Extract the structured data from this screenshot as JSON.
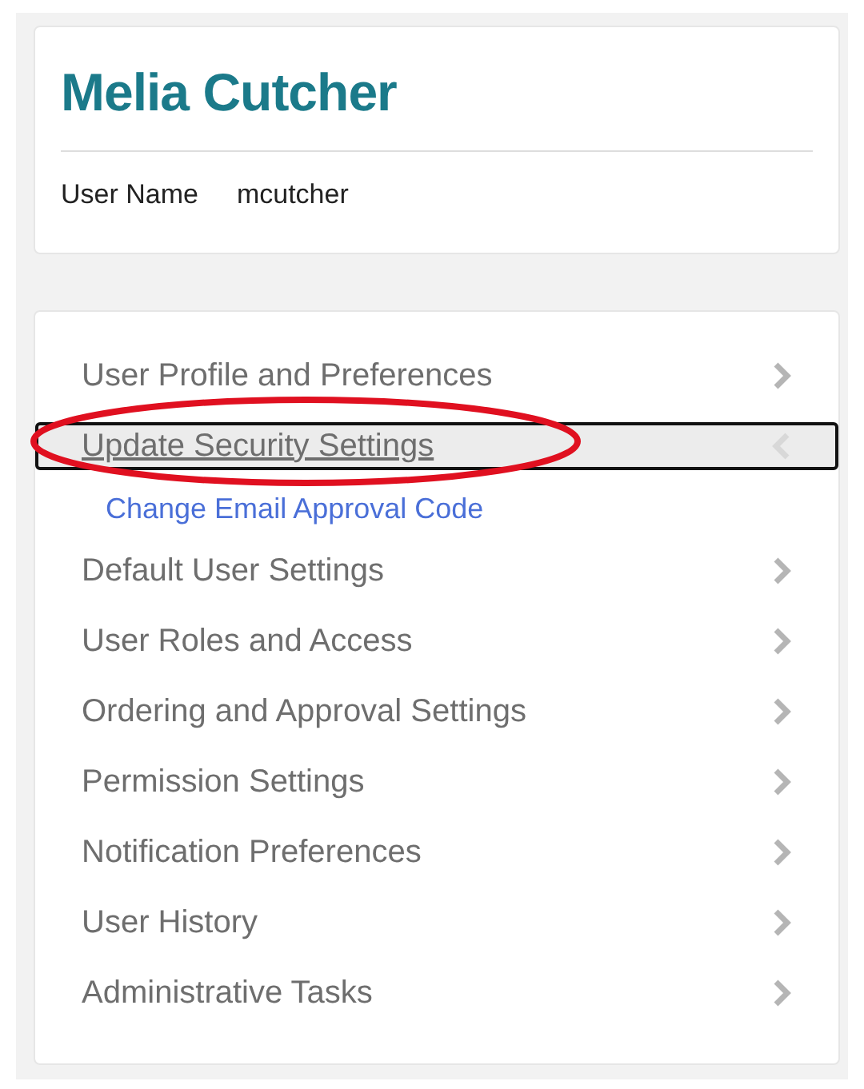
{
  "profile": {
    "name": "Melia Cutcher",
    "field_label": "User Name",
    "field_value": "mcutcher"
  },
  "menu": [
    {
      "label": "User Profile and Preferences",
      "selected": false,
      "expanded": false,
      "circled": false
    },
    {
      "label": "Update Security Settings",
      "selected": true,
      "expanded": true,
      "circled": true,
      "children": [
        {
          "label": "Change Email Approval Code"
        }
      ]
    },
    {
      "label": "Default User Settings",
      "selected": false,
      "expanded": false,
      "circled": false
    },
    {
      "label": "User Roles and Access",
      "selected": false,
      "expanded": false,
      "circled": false
    },
    {
      "label": "Ordering and Approval Settings",
      "selected": false,
      "expanded": false,
      "circled": false
    },
    {
      "label": "Permission Settings",
      "selected": false,
      "expanded": false,
      "circled": false
    },
    {
      "label": "Notification Preferences",
      "selected": false,
      "expanded": false,
      "circled": false
    },
    {
      "label": "User History",
      "selected": false,
      "expanded": false,
      "circled": false
    },
    {
      "label": "Administrative Tasks",
      "selected": false,
      "expanded": false,
      "circled": false
    }
  ]
}
